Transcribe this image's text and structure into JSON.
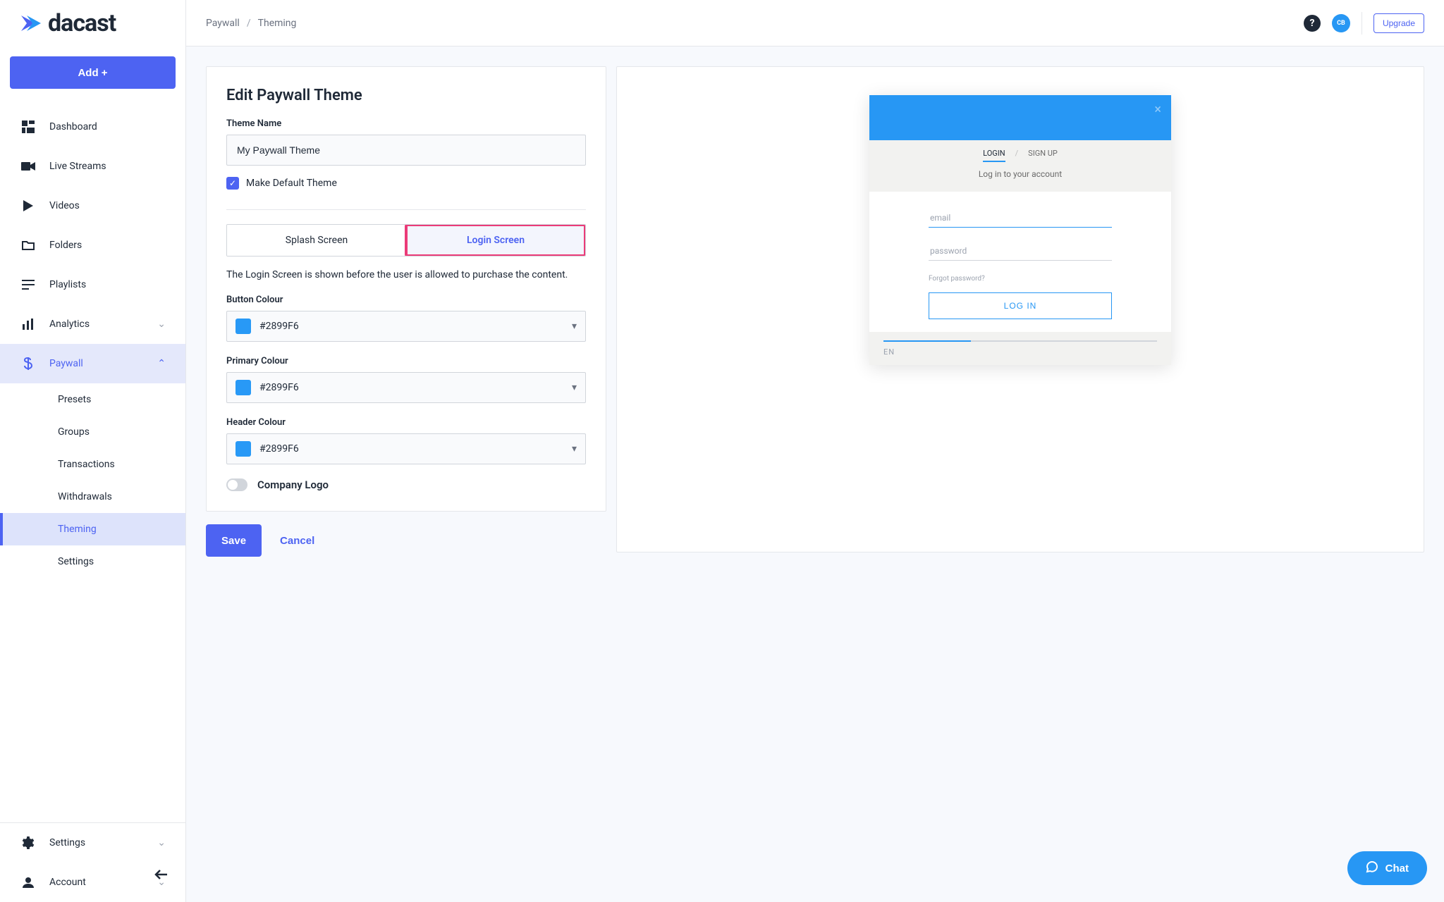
{
  "brand": "dacast",
  "addButton": "Add +",
  "nav": {
    "dashboard": "Dashboard",
    "liveStreams": "Live Streams",
    "videos": "Videos",
    "folders": "Folders",
    "playlists": "Playlists",
    "analytics": "Analytics",
    "paywall": "Paywall",
    "presets": "Presets",
    "groups": "Groups",
    "transactions": "Transactions",
    "withdrawals": "Withdrawals",
    "theming": "Theming",
    "settings": "Settings",
    "footerSettings": "Settings",
    "account": "Account"
  },
  "breadcrumb": {
    "root": "Paywall",
    "leaf": "Theming"
  },
  "topbar": {
    "avatar": "CB",
    "upgrade": "Upgrade"
  },
  "panel": {
    "title": "Edit Paywall Theme",
    "themeNameLabel": "Theme Name",
    "themeNameValue": "My Paywall Theme",
    "makeDefault": "Make Default Theme",
    "tabSplash": "Splash Screen",
    "tabLogin": "Login Screen",
    "loginDesc": "The Login Screen is shown before the user is allowed to purchase the content.",
    "buttonColourLabel": "Button Colour",
    "primaryColourLabel": "Primary Colour",
    "headerColourLabel": "Header Colour",
    "colourValue": "#2899F6",
    "colourHex": "#2899F6",
    "companyLogo": "Company Logo",
    "save": "Save",
    "cancel": "Cancel"
  },
  "preview": {
    "tabLogin": "LOGIN",
    "tabSignup": "SIGN UP",
    "subtext": "Log in to your account",
    "emailPh": "email",
    "passwordPh": "password",
    "forgot": "Forgot password?",
    "loginBtn": "LOG IN",
    "lang": "EN"
  },
  "chat": "Chat"
}
